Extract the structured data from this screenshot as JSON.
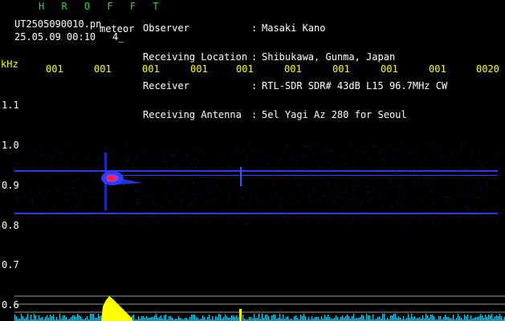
{
  "brand": "HROFFT",
  "file": {
    "name": "UT2505090010.pn",
    "tag": "meteor",
    "datetime": "25.05.09 00:10",
    "count": "4_"
  },
  "info": {
    "labels": [
      "Observer",
      "Receiving Location",
      "Receiver",
      "Receiving Antenna"
    ],
    "colons": [
      ":",
      ":",
      ":",
      ":"
    ],
    "values": [
      "Masaki Kano",
      "Shibukawa, Gunma, Japan",
      "RTL-SDR SDR# 43dB L15 96.7MHz CW",
      "5el Yagi Az 280 for Seoul"
    ]
  },
  "axis": {
    "unit": "kHz",
    "time_ticks": [
      "001",
      "001",
      "001",
      "001",
      "001",
      "001",
      "001",
      "001",
      "001",
      "0020"
    ],
    "freq_ticks": [
      "1.1",
      "1.0",
      "0.9",
      "0.8",
      "0.7",
      "0.6"
    ]
  },
  "colors": {
    "label_green": "#27d53e",
    "text_white": "#ffffff",
    "tick_yellow": "#ffff00",
    "signal_blue": "#2a3cff",
    "meteor_red": "#ff2244",
    "level_cyan": "#00e0ff",
    "level_yellow": "#ffff00"
  }
}
